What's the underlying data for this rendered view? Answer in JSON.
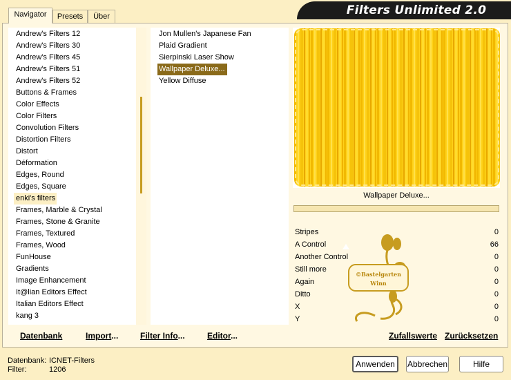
{
  "title": "Filters Unlimited 2.0",
  "tabs": [
    {
      "label": "Navigator"
    },
    {
      "label": "Presets"
    },
    {
      "label": "Über"
    }
  ],
  "categories": [
    "Andrew's Filters 12",
    "Andrew's Filters 30",
    "Andrew's Filters 45",
    "Andrew's Filters 51",
    "Andrew's Filters 52",
    "Buttons & Frames",
    "Color Effects",
    "Color Filters",
    "Convolution Filters",
    "Distortion Filters",
    "Distort",
    "Déformation",
    "Edges, Round",
    "Edges, Square",
    "enki's filters",
    "Frames, Marble & Crystal",
    "Frames, Stone & Granite",
    "Frames, Textured",
    "Frames, Wood",
    "FunHouse",
    "Gradients",
    "Image Enhancement",
    "It@lian Editors Effect",
    "Italian Editors Effect",
    "kang 3"
  ],
  "filters": [
    "Jon Mullen's Japanese Fan",
    "Plaid Gradient",
    "Sierpinski Laser Show",
    "Wallpaper Deluxe...",
    "Yellow Diffuse"
  ],
  "preview_label": "Wallpaper Deluxe...",
  "params": [
    {
      "name": "Stripes",
      "value": "0"
    },
    {
      "name": "A Control",
      "value": "66"
    },
    {
      "name": "Another Control",
      "value": "0"
    },
    {
      "name": "Still more",
      "value": "0"
    },
    {
      "name": "Again",
      "value": "0"
    },
    {
      "name": "Ditto",
      "value": "0"
    },
    {
      "name": "X",
      "value": "0"
    },
    {
      "name": "Y",
      "value": "0"
    }
  ],
  "buttons": {
    "datenbank": "Datenbank",
    "import": "Import...",
    "filter_info": "Filter Info...",
    "editor": "Editor...",
    "zufallswerte": "Zufallswerte",
    "zuruecksetzen": "Zurücksetzen",
    "anwenden": "Anwenden",
    "abbrechen": "Abbrechen",
    "hilfe": "Hilfe"
  },
  "status": {
    "db_label": "Datenbank:",
    "db_value": "ICNET-Filters",
    "filter_label": "Filter:",
    "filter_value": "1206"
  },
  "watermark": "©Bastelgarten Winn",
  "colors": {
    "background": "#fcefc4",
    "selection": "#8a6a1a",
    "accent_gold": "#c79c20",
    "preview_yellow": "#ffd21a"
  }
}
